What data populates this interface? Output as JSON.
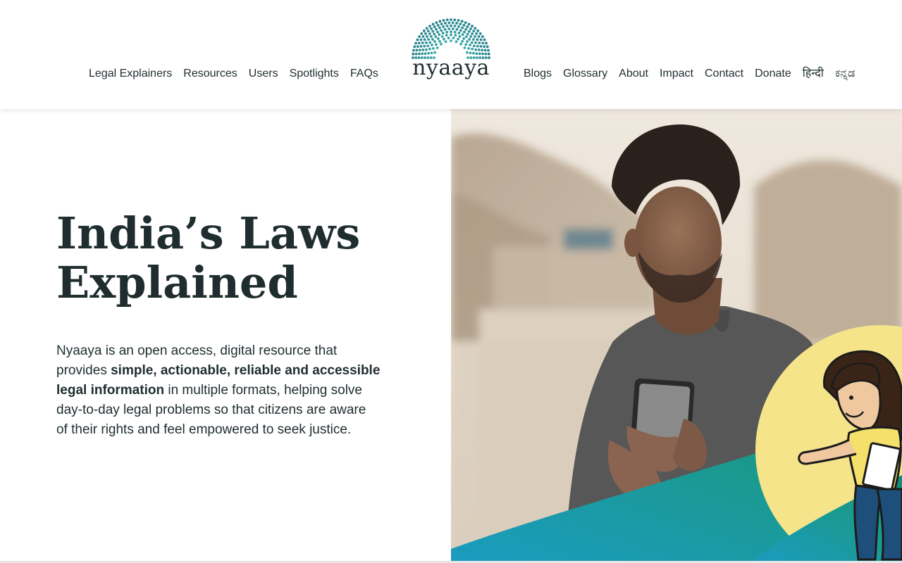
{
  "header": {
    "logo_text": "nyaaya",
    "nav_left": [
      "Legal Explainers",
      "Resources",
      "Users",
      "Spotlights",
      "FAQs"
    ],
    "nav_right": [
      "Blogs",
      "Glossary",
      "About",
      "Impact",
      "Contact",
      "Donate"
    ],
    "languages": [
      "हिन्दी",
      "ಕನ್ನಡ"
    ]
  },
  "hero": {
    "title_line1": "India’s Laws",
    "title_line2": "Explained",
    "desc_part1": "Nyaaya is an open access, digital resource that provides ",
    "desc_bold": "simple, actionable, reliable and accessible legal information",
    "desc_part2": " in multiple formats, helping solve day-to-day legal problems so that citizens are aware of their rights and feel empowered to seek justice."
  },
  "colors": {
    "text": "#1f2d2f",
    "teal": "#1a9a8f",
    "blue": "#1d8fb8",
    "yellow": "#f6e48a"
  },
  "icons": {
    "logo_mark": "semicircle-dot-arc",
    "hero_image": "man-using-phone-photo",
    "illustration": "woman-with-paper-cartoon"
  }
}
